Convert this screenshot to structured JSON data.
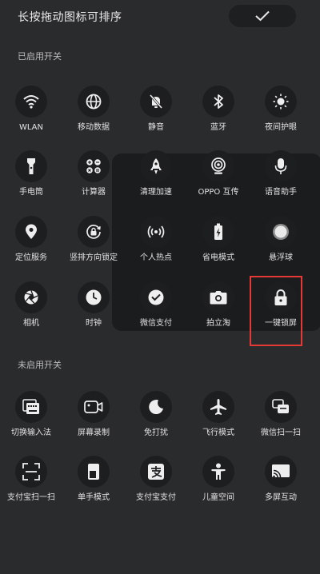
{
  "header": {
    "title": "长按拖动图标可排序",
    "confirm_icon": "check-icon"
  },
  "enabled_section": {
    "label": "已启用开关",
    "items": [
      {
        "label": "WLAN",
        "icon": "wifi-icon"
      },
      {
        "label": "移动数据",
        "icon": "globe-icon"
      },
      {
        "label": "静音",
        "icon": "mute-bell-icon"
      },
      {
        "label": "蓝牙",
        "icon": "bluetooth-icon"
      },
      {
        "label": "夜间护眼",
        "icon": "night-eye-icon"
      },
      {
        "label": "手电筒",
        "icon": "flashlight-icon"
      },
      {
        "label": "计算器",
        "icon": "calculator-icon"
      },
      {
        "label": "清理加速",
        "icon": "rocket-icon"
      },
      {
        "label": "OPPO 互传",
        "icon": "share-signal-icon"
      },
      {
        "label": "语音助手",
        "icon": "microphone-icon"
      },
      {
        "label": "定位服务",
        "icon": "location-icon"
      },
      {
        "label": "竖排方向锁定",
        "icon": "rotation-lock-icon"
      },
      {
        "label": "个人热点",
        "icon": "hotspot-icon"
      },
      {
        "label": "省电模式",
        "icon": "battery-saver-icon"
      },
      {
        "label": "悬浮球",
        "icon": "floating-ball-icon"
      },
      {
        "label": "相机",
        "icon": "aperture-icon"
      },
      {
        "label": "时钟",
        "icon": "clock-icon"
      },
      {
        "label": "微信支付",
        "icon": "wechat-pay-icon"
      },
      {
        "label": "拍立淘",
        "icon": "camera-icon"
      },
      {
        "label": "一键锁屏",
        "icon": "lock-icon"
      }
    ]
  },
  "disabled_section": {
    "label": "未启用开关",
    "items": [
      {
        "label": "切换输入法",
        "icon": "keyboard-icon"
      },
      {
        "label": "屏幕录制",
        "icon": "video-record-icon"
      },
      {
        "label": "免打扰",
        "icon": "moon-icon"
      },
      {
        "label": "飞行模式",
        "icon": "airplane-icon"
      },
      {
        "label": "微信扫一扫",
        "icon": "wechat-scan-icon"
      },
      {
        "label": "支付宝扫一扫",
        "icon": "scan-frame-icon"
      },
      {
        "label": "单手模式",
        "icon": "one-hand-icon"
      },
      {
        "label": "支付宝支付",
        "icon": "alipay-icon"
      },
      {
        "label": "儿童空间",
        "icon": "child-icon"
      },
      {
        "label": "多屏互动",
        "icon": "cast-screen-icon"
      }
    ]
  },
  "colors": {
    "highlight_border": "#e53935",
    "background": "#2a2b2d",
    "circle": "#1d1e20"
  }
}
